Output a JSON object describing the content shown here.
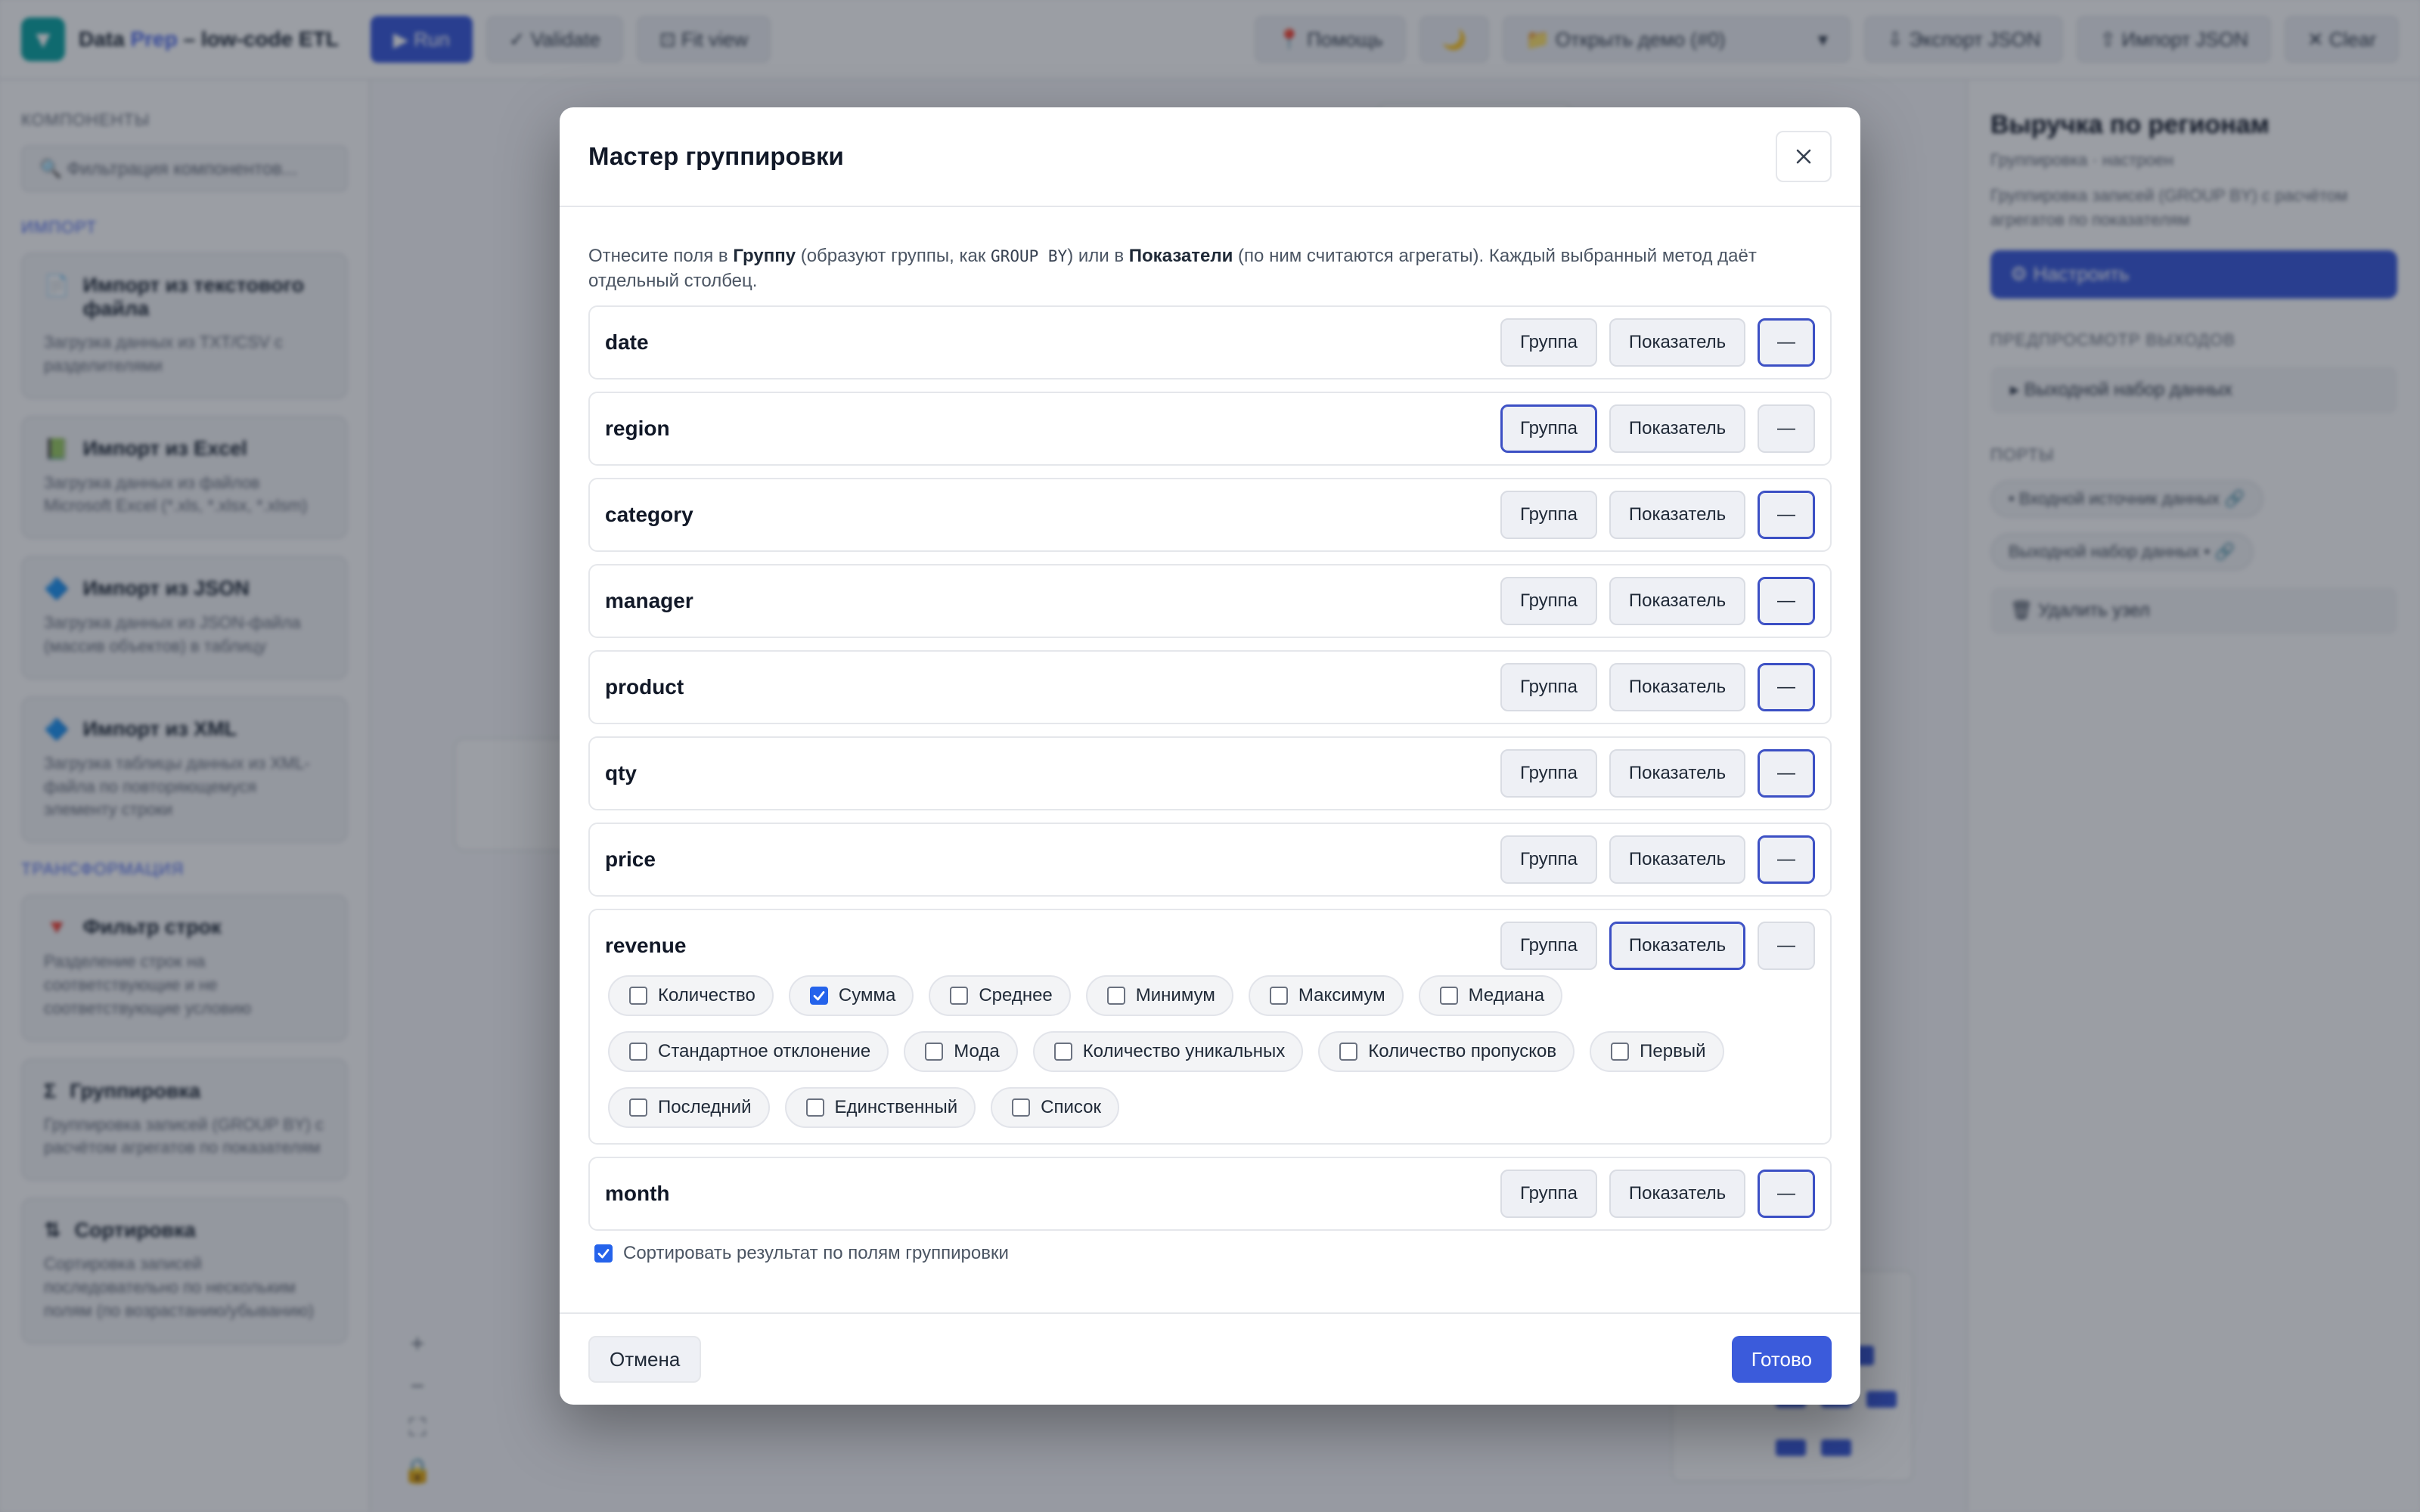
{
  "app": {
    "brand_name": "Data",
    "brand_accent": "Prep",
    "brand_suffix": "– low-code ETL",
    "toolbar": {
      "run": "▶ Run",
      "validate": "✓ Validate",
      "fit_view": "⊡ Fit view",
      "help": "📍 Помощь",
      "theme": "🌙",
      "demo_select": "📁 Открыть демо (#0)",
      "export_json": "⇩ Экспорт JSON",
      "import_json": "⇧ Импорт JSON",
      "clear": "✕ Clear"
    },
    "left_panel": {
      "components_heading": "Компоненты",
      "filter_placeholder": "🔍 Фильтрация компонентов...",
      "import_heading": "Импорт",
      "transform_heading": "Трансформация",
      "import_items": [
        {
          "icon": "📄",
          "title": "Импорт из текстового файла",
          "desc": "Загрузка данных из TXT/CSV с разделителями"
        },
        {
          "icon": "📗",
          "title": "Импорт из Excel",
          "desc": "Загрузка данных из файлов Microsoft Excel (*.xls, *.xlsx, *.xlsm)"
        },
        {
          "icon": "🔷",
          "title": "Импорт из JSON",
          "desc": "Загрузка данных из JSON-файла (массив объектов) в таблицу"
        },
        {
          "icon": "🔷",
          "title": "Импорт из XML",
          "desc": "Загрузка таблицы данных из XML-файла по повторяющемуся элементу строки"
        }
      ],
      "transform_items": [
        {
          "icon": "🔻",
          "title": "Фильтр строк",
          "desc": "Разделение строк на соответствующие и не соответствующие условию"
        },
        {
          "icon": "Σ",
          "title": "Группировка",
          "desc": "Группировка записей (GROUP BY) с расчётом агрегатов по показателям"
        },
        {
          "icon": "⇅",
          "title": "Сортировка",
          "desc": "Сортировка записей последовательно по нескольким полям (по возрастанию/убыванию)"
        }
      ]
    },
    "canvas_tools": [
      "+",
      "−",
      "⛶",
      "🔒"
    ],
    "right_panel": {
      "title": "Выручка по регионам",
      "subtitle": "Группировка · настроен",
      "desc": "Группировка записей (GROUP BY) с расчётом агрегатов по показателям",
      "configure_btn": "⚙ Настроить",
      "preview_heading": "Предпросмотр выходов",
      "output_dataset": "▸ Выходной набор данных",
      "ports_heading": "Порты",
      "port_in": "• Входной источник данных 🔗",
      "port_out": "Выходной набор данных • 🔗",
      "delete_btn": "🗑 Удалить узел"
    }
  },
  "modal": {
    "title": "Мастер группировки",
    "intro_a": "Отнесите поля в ",
    "intro_b": "Группу",
    "intro_c": " (образуют группы, как ",
    "intro_code": "GROUP BY",
    "intro_d": ") или в ",
    "intro_e": "Показатели",
    "intro_f": " (по ним считаются агрегаты). Каждый выбранный метод даёт отдельный столбец.",
    "labels": {
      "group": "Группа",
      "metric": "Показатель",
      "none": "—"
    },
    "fields": [
      {
        "name": "date",
        "role": "none"
      },
      {
        "name": "region",
        "role": "group"
      },
      {
        "name": "category",
        "role": "none"
      },
      {
        "name": "manager",
        "role": "none"
      },
      {
        "name": "product",
        "role": "none"
      },
      {
        "name": "qty",
        "role": "none"
      },
      {
        "name": "price",
        "role": "none"
      },
      {
        "name": "revenue",
        "role": "metric"
      },
      {
        "name": "month",
        "role": "none"
      }
    ],
    "aggregations": [
      {
        "label": "Количество",
        "checked": false
      },
      {
        "label": "Сумма",
        "checked": true
      },
      {
        "label": "Среднее",
        "checked": false
      },
      {
        "label": "Минимум",
        "checked": false
      },
      {
        "label": "Максимум",
        "checked": false
      },
      {
        "label": "Медиана",
        "checked": false
      },
      {
        "label": "Стандартное отклонение",
        "checked": false
      },
      {
        "label": "Мода",
        "checked": false
      },
      {
        "label": "Количество уникальных",
        "checked": false
      },
      {
        "label": "Количество пропусков",
        "checked": false
      },
      {
        "label": "Первый",
        "checked": false
      },
      {
        "label": "Последний",
        "checked": false
      },
      {
        "label": "Единственный",
        "checked": false
      },
      {
        "label": "Список",
        "checked": false
      }
    ],
    "sort_label": "Сортировать результат по полям группировки",
    "sort_checked": true,
    "cancel": "Отмена",
    "done": "Готово"
  },
  "colors": {
    "accent": "#3b5bdb",
    "active_border": "#3b4fc4",
    "checkbox_on": "#2563eb"
  }
}
